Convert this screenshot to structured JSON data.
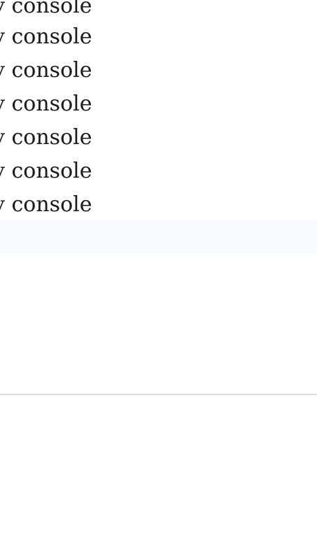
{
  "list": {
    "items": [
      {
        "label": "y console"
      },
      {
        "label": "y console"
      },
      {
        "label": "y console"
      },
      {
        "label": "y console"
      },
      {
        "label": "y console"
      },
      {
        "label": "y console"
      },
      {
        "label": "y console"
      }
    ]
  },
  "colors": {
    "text": "#1a1a1a",
    "selected_row_bg": "#f7fbff",
    "divider": "#dddddd",
    "background": "#ffffff"
  }
}
